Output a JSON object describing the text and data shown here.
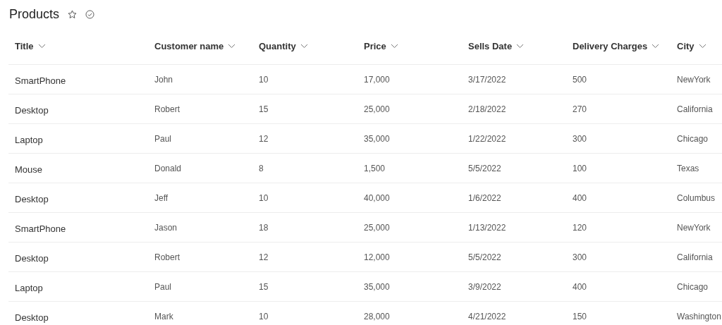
{
  "page": {
    "title": "Products"
  },
  "table": {
    "columns": [
      "Title",
      "Customer name",
      "Quantity",
      "Price",
      "Sells Date",
      "Delivery Charges",
      "City"
    ],
    "rows": [
      [
        "SmartPhone",
        "John",
        "10",
        "17,000",
        "3/17/2022",
        "500",
        "NewYork"
      ],
      [
        "Desktop",
        "Robert",
        "15",
        "25,000",
        "2/18/2022",
        "270",
        "California"
      ],
      [
        "Laptop",
        "Paul",
        "12",
        "35,000",
        "1/22/2022",
        "300",
        "Chicago"
      ],
      [
        "Mouse",
        "Donald",
        "8",
        "1,500",
        "5/5/2022",
        "100",
        "Texas"
      ],
      [
        "Desktop",
        "Jeff",
        "10",
        "40,000",
        "1/6/2022",
        "400",
        "Columbus"
      ],
      [
        "SmartPhone",
        "Jason",
        "18",
        "25,000",
        "1/13/2022",
        "120",
        "NewYork"
      ],
      [
        "Desktop",
        "Robert",
        "12",
        "12,000",
        "5/5/2022",
        "300",
        "California"
      ],
      [
        "Laptop",
        "Paul",
        "15",
        "35,000",
        "3/9/2022",
        "400",
        "Chicago"
      ],
      [
        "Desktop",
        "Mark",
        "10",
        "28,000",
        "4/21/2022",
        "150",
        "Washington"
      ]
    ]
  }
}
